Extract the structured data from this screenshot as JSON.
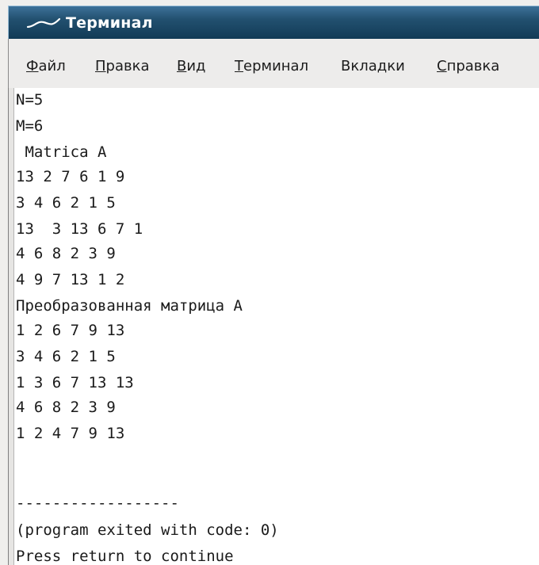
{
  "window": {
    "title": "Терминал"
  },
  "menu": [
    {
      "mnemonic": "Ф",
      "rest": "айл"
    },
    {
      "mnemonic": "П",
      "rest": "равка"
    },
    {
      "mnemonic": "В",
      "rest": "ид"
    },
    {
      "mnemonic": "Т",
      "rest": "ерминал"
    },
    {
      "mnemonic": "",
      "rest": "Вкладки"
    },
    {
      "mnemonic": "С",
      "rest": "правка"
    }
  ],
  "terminal": {
    "lines": [
      "N=5",
      "M=6",
      " Matrica A",
      "13 2 7 6 1 9",
      "3 4 6 2 1 5",
      "13  3 13 6 7 1",
      "4 6 8 2 3 9",
      "4 9 7 13 1 2",
      "Преобразованная матрица A",
      "1 2 6 7 9 13",
      "3 4 6 2 1 5",
      "1 3 6 7 13 13",
      "4 6 8 2 3 9",
      "1 2 4 7 9 13",
      "",
      "",
      "",
      "------------------",
      "(program exited with code: 0)",
      "Press return to continue"
    ]
  },
  "colors": {
    "titlebar": "#22506f",
    "terminal_bg": "#ffffff",
    "terminal_fg": "#1a1a1a"
  }
}
